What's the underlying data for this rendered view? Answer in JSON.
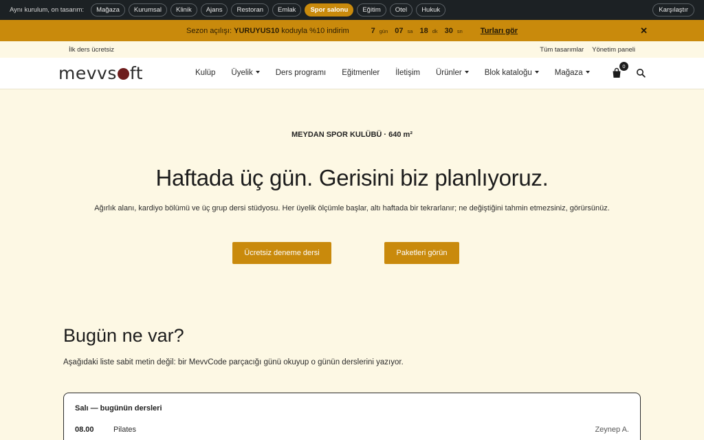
{
  "demo_bar": {
    "lead": "Aynı kurulum, on tasarım:",
    "items": [
      "Mağaza",
      "Kurumsal",
      "Klinik",
      "Ajans",
      "Restoran",
      "Emlak",
      "Spor salonu",
      "Eğitim",
      "Otel",
      "Hukuk"
    ],
    "active_index": 6,
    "compare_label": "Karşılaştır"
  },
  "promo": {
    "prefix": "Sezon açılışı:",
    "code": "YURUYUS10",
    "suffix": "koduyla %10 indirim",
    "countdown": [
      {
        "value": "7",
        "unit": "gün"
      },
      {
        "value": "07",
        "unit": "sa"
      },
      {
        "value": "18",
        "unit": "dk"
      },
      {
        "value": "30",
        "unit": "sn"
      }
    ],
    "link_label": "Turları gör",
    "close_icon": "close-icon"
  },
  "util": {
    "left": "İlk ders ücretsiz",
    "right": [
      "Tüm tasarımlar",
      "Yönetim paneli"
    ]
  },
  "nav": {
    "logo_before": "mevvs",
    "logo_after": "ft",
    "brand_color": "#6e1d1d",
    "items": [
      {
        "label": "Kulüp",
        "dropdown": false
      },
      {
        "label": "Üyelik",
        "dropdown": true
      },
      {
        "label": "Ders programı",
        "dropdown": false
      },
      {
        "label": "Eğitmenler",
        "dropdown": false
      },
      {
        "label": "İletişim",
        "dropdown": false
      },
      {
        "label": "Ürünler",
        "dropdown": true
      },
      {
        "label": "Blok kataloğu",
        "dropdown": true
      },
      {
        "label": "Mağaza",
        "dropdown": true
      }
    ],
    "cart_count": "0"
  },
  "hero": {
    "eyebrow": "MEYDAN SPOR KULÜBÜ · 640 m²",
    "headline": "Haftada üç gün. Gerisini biz planlıyoruz.",
    "lede": "Ağırlık alanı, kardiyo bölümü ve üç grup dersi stüdyosu. Her üyelik ölçümle başlar, altı haftada bir tekrarlanır; ne değiştiğini tahmin etmezsiniz, görürsünüz.",
    "primary_cta": "Ücretsiz deneme dersi",
    "secondary_cta": "Paketleri görün",
    "accent_color": "#c98a0c"
  },
  "today": {
    "title": "Bugün ne var?",
    "description": "Aşağıdaki liste sabit metin değil: bir MevvCode parçacığı günü okuyup o günün derslerini yazıyor.",
    "card_title": "Salı — bugünün dersleri",
    "rows": [
      {
        "time": "08.00",
        "class": "Pilates",
        "coach": "Zeynep A."
      }
    ]
  }
}
